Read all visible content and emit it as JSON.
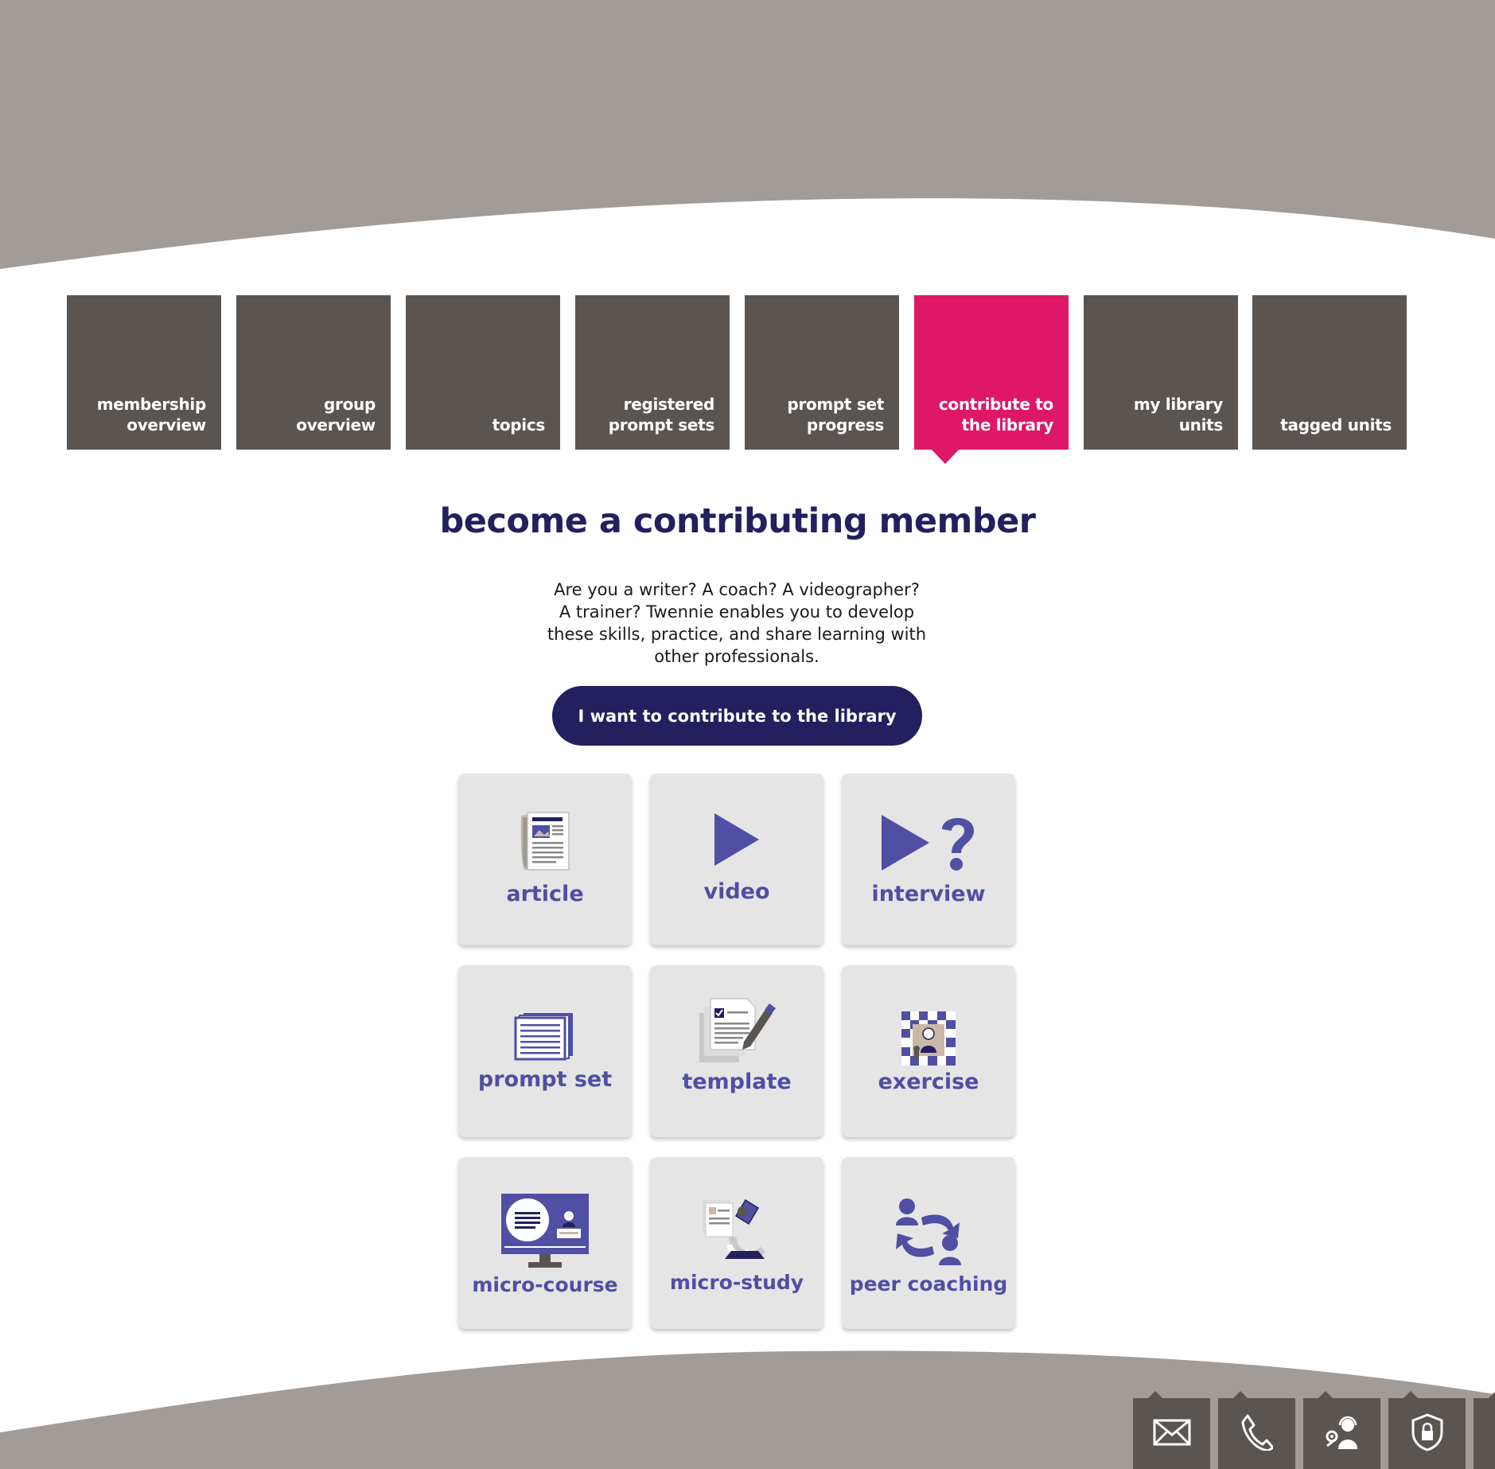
{
  "colors": {
    "header_bg": "#a39b96",
    "tab_bg": "#5b5552",
    "tab_active": "#de1767",
    "navy": "#241f5e",
    "card_bg": "#e6e5e6",
    "card_label": "#4f4fa3"
  },
  "tabs": [
    {
      "lines": [
        "membership",
        "overview"
      ],
      "active": false
    },
    {
      "lines": [
        "group",
        "overview"
      ],
      "active": false
    },
    {
      "lines": [
        "topics"
      ],
      "active": false
    },
    {
      "lines": [
        "registered",
        "prompt sets"
      ],
      "active": false
    },
    {
      "lines": [
        "prompt set",
        "progress"
      ],
      "active": false
    },
    {
      "lines": [
        "contribute to",
        "the library"
      ],
      "active": true
    },
    {
      "lines": [
        "my library",
        "units"
      ],
      "active": false
    },
    {
      "lines": [
        "tagged units"
      ],
      "active": false
    }
  ],
  "main": {
    "title": "become a contributing member",
    "intro": [
      "Are you a writer? A coach? A videographer?",
      "A trainer? Twennie enables you to develop",
      "these skills, practice, and share learning with",
      "other professionals."
    ],
    "cta": "I want to contribute to the library"
  },
  "cards": [
    {
      "label": "article",
      "icon": "newspaper-icon"
    },
    {
      "label": "video",
      "icon": "play-icon"
    },
    {
      "label": "interview",
      "icon": "play-question-icon"
    },
    {
      "label": "prompt set",
      "icon": "stacked-pages-icon"
    },
    {
      "label": "template",
      "icon": "document-pen-icon"
    },
    {
      "label": "exercise",
      "icon": "chessboard-icon"
    },
    {
      "label": "micro-course",
      "icon": "monitor-presentation-icon"
    },
    {
      "label": "micro-study",
      "icon": "microscope-icon"
    },
    {
      "label": "peer coaching",
      "icon": "people-exchange-icon"
    }
  ],
  "footer_bar": [
    {
      "icon": "mail-icon"
    },
    {
      "icon": "phone-icon"
    },
    {
      "icon": "support-agent-icon"
    },
    {
      "icon": "shield-lock-icon"
    }
  ]
}
